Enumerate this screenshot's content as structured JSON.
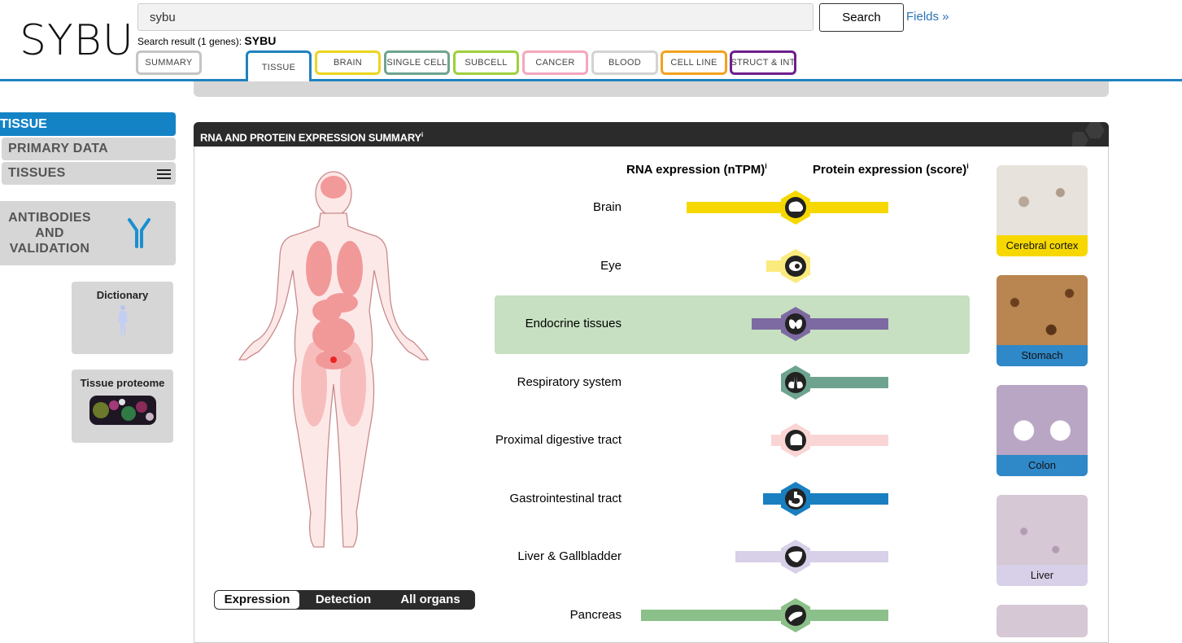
{
  "header": {
    "logo": "SYBU",
    "search_value": "sybu",
    "search_button": "Search",
    "fields_link": "Fields »",
    "result_prefix": "Search result (1 genes):",
    "result_gene": "SYBU"
  },
  "tabs": [
    {
      "label": "SUMMARY",
      "color": "#c5c5c5",
      "active": false
    },
    {
      "label": "TISSUE",
      "color": "#1f82bf",
      "active": true
    },
    {
      "label": "BRAIN",
      "color": "#ecd520",
      "active": false
    },
    {
      "label": "SINGLE CELL",
      "color": "#6ea48f",
      "active": false
    },
    {
      "label": "SUBCELL",
      "color": "#9fcf3c",
      "active": false
    },
    {
      "label": "CANCER",
      "color": "#f4a7bd",
      "active": false
    },
    {
      "label": "BLOOD",
      "color": "#d3d3d3",
      "active": false
    },
    {
      "label": "CELL LINE",
      "color": "#f1a220",
      "active": false
    },
    {
      "label": "STRUCT & INT",
      "color": "#6e1f8c",
      "active": false
    }
  ],
  "sidebar": {
    "active": "TISSUE",
    "items": [
      "PRIMARY DATA",
      "TISSUES"
    ],
    "antibodies": "ANTIBODIES\nAND\nVALIDATION",
    "dictionary": "Dictionary",
    "tissue_proteome": "Tissue proteome"
  },
  "panel": {
    "title": "RNA AND PROTEIN EXPRESSION SUMMARY",
    "info": "i",
    "rna_header": "RNA expression (nTPM)",
    "protein_header": "Protein expression (score)",
    "toggle": [
      "Expression",
      "Detection",
      "All organs"
    ],
    "organs": [
      {
        "label": "Brain",
        "rna": 0.67,
        "protein": 0.5,
        "color": "#f6d800",
        "light": false,
        "icon": "brain-icon"
      },
      {
        "label": "Eye",
        "rna": 0.18,
        "protein": 0,
        "color": "#fbea7e",
        "light": true,
        "icon": "eye-icon"
      },
      {
        "label": "Endocrine tissues",
        "rna": 0.27,
        "protein": 0.5,
        "color": "#7e6aa2",
        "light": false,
        "icon": "thyroid-icon",
        "selected": true
      },
      {
        "label": "Respiratory system",
        "rna": 0.06,
        "protein": 0.5,
        "color": "#6ea48f",
        "light": false,
        "icon": "lungs-icon"
      },
      {
        "label": "Proximal digestive tract",
        "rna": 0.15,
        "protein": 0.5,
        "color": "#fad5d5",
        "light": true,
        "icon": "head-icon"
      },
      {
        "label": "Gastrointestinal tract",
        "rna": 0.2,
        "protein": 0.5,
        "color": "#1a7fc1",
        "light": false,
        "icon": "stomach-icon"
      },
      {
        "label": "Liver & Gallbladder",
        "rna": 0.37,
        "protein": 0.5,
        "color": "#d8d0e8",
        "light": true,
        "icon": "liver-icon"
      },
      {
        "label": "Pancreas",
        "rna": 0.95,
        "protein": 0.5,
        "color": "#8cc08a",
        "light": false,
        "icon": "pancreas-icon"
      }
    ],
    "thumbnails": [
      {
        "label": "Cerebral cortex",
        "bar": "#f6d800"
      },
      {
        "label": "Stomach",
        "bar": "#2f88c8"
      },
      {
        "label": "Colon",
        "bar": "#2f88c8"
      },
      {
        "label": "Liver",
        "bar": "#d8d0e8"
      },
      {
        "label": "",
        "bar": "#d8d0e8"
      }
    ]
  }
}
